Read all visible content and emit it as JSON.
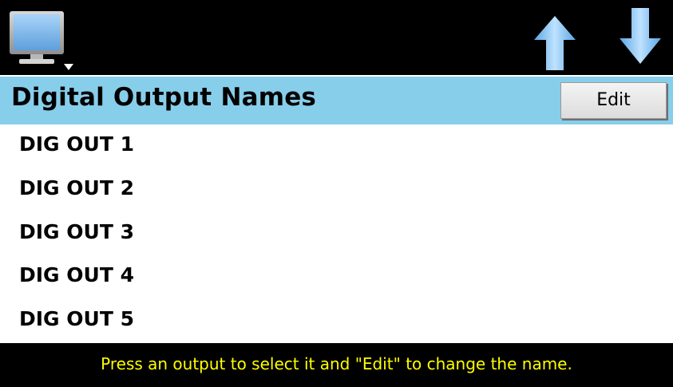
{
  "toolbar": {
    "monitor_icon": "monitor-menu-icon",
    "up_icon": "arrow-up-icon",
    "down_icon": "arrow-down-icon"
  },
  "header": {
    "title": "Digital Output Names",
    "edit_label": "Edit"
  },
  "outputs": [
    {
      "label": "DIG OUT 1"
    },
    {
      "label": "DIG OUT 2"
    },
    {
      "label": "DIG OUT 3"
    },
    {
      "label": "DIG OUT 4"
    },
    {
      "label": "DIG OUT 5"
    }
  ],
  "footer": {
    "hint": "Press an output to select it and \"Edit\" to change the name."
  },
  "colors": {
    "background": "#000000",
    "header_bg": "#87ceeb",
    "list_bg": "#ffffff",
    "hint_text": "#ffff00",
    "arrow_fill": "#6fb8ec"
  }
}
